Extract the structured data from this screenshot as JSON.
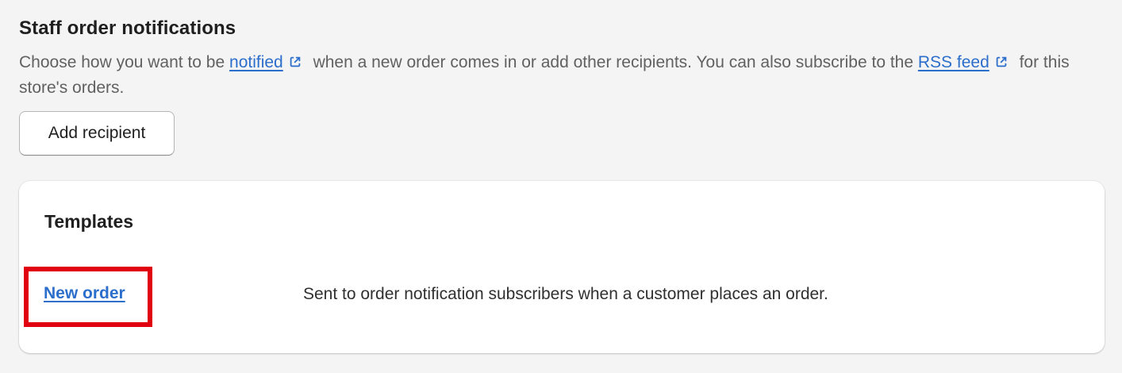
{
  "section": {
    "title": "Staff order notifications",
    "description_part1": "Choose how you want to be ",
    "notified_link": "notified",
    "description_part2": " when a new order comes in or add other recipients. You can also subscribe to the ",
    "rss_link": "RSS feed",
    "description_part3": " for this store's orders.",
    "add_recipient_label": "Add recipient"
  },
  "templates": {
    "title": "Templates",
    "items": [
      {
        "name": "New order",
        "description": "Sent to order notification subscribers when a customer places an order."
      }
    ]
  },
  "colors": {
    "link": "#2c6ecb",
    "highlight_box": "#e0000f",
    "background": "#f4f4f4"
  },
  "icons": {
    "external_link": "external-link-icon"
  }
}
